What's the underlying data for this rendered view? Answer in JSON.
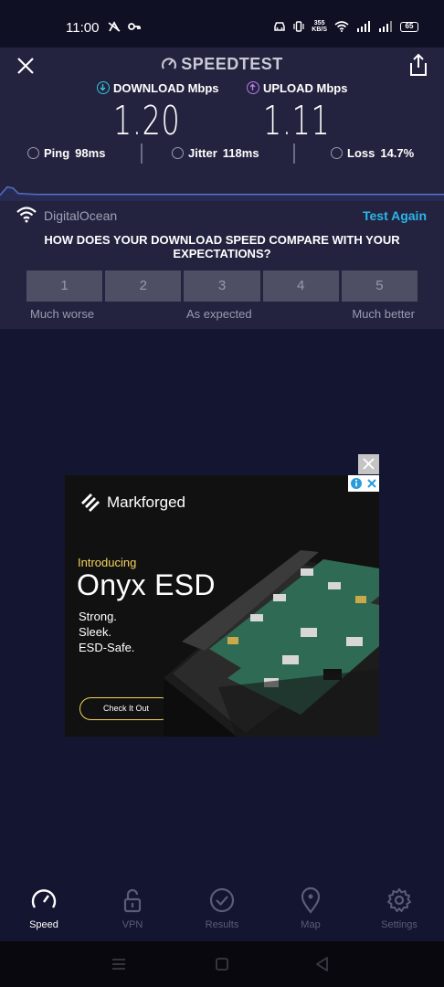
{
  "status_bar": {
    "time": "11:00",
    "net_speed_value": "355",
    "net_speed_unit": "KB/S",
    "battery": "65",
    "icons": [
      "no-signal-icon",
      "key-icon",
      "car-icon",
      "vibrate-icon",
      "wifi-icon",
      "signal-icon",
      "signal-icon",
      "battery-icon"
    ]
  },
  "header": {
    "brand": "SPEEDTEST",
    "close_icon": "close-icon",
    "share_icon": "share-icon"
  },
  "metrics": {
    "download_label": "DOWNLOAD Mbps",
    "download_value": "1.20",
    "upload_label": "UPLOAD Mbps",
    "upload_value": "1.11",
    "download_color": "#36c3d8",
    "upload_color": "#b97ce8"
  },
  "stats": {
    "ping_label": "Ping",
    "ping_value": "98ms",
    "jitter_label": "Jitter",
    "jitter_value": "118ms",
    "loss_label": "Loss",
    "loss_value": "14.7%"
  },
  "server": {
    "name": "DigitalOcean",
    "test_again": "Test Again",
    "accent": "#2bb6ea"
  },
  "survey": {
    "question": "HOW DOES YOUR DOWNLOAD SPEED COMPARE WITH YOUR EXPECTATIONS?",
    "options": [
      "1",
      "2",
      "3",
      "4",
      "5"
    ],
    "label_low": "Much worse",
    "label_mid": "As expected",
    "label_high": "Much better"
  },
  "ad": {
    "brand": "Markforged",
    "intro": "Introducing",
    "product": "Onyx ESD",
    "lines": [
      "Strong.",
      "Sleek.",
      "ESD-Safe."
    ],
    "cta": "Check It Out",
    "accent": "#f4d35a"
  },
  "nav": {
    "items": [
      {
        "label": "Speed",
        "icon": "speedometer-icon",
        "active": true
      },
      {
        "label": "VPN",
        "icon": "lock-icon",
        "active": false
      },
      {
        "label": "Results",
        "icon": "check-circle-icon",
        "active": false
      },
      {
        "label": "Map",
        "icon": "map-pin-icon",
        "active": false
      },
      {
        "label": "Settings",
        "icon": "gear-icon",
        "active": false
      }
    ]
  },
  "system_nav": [
    "menu-icon",
    "home-icon",
    "back-icon"
  ]
}
